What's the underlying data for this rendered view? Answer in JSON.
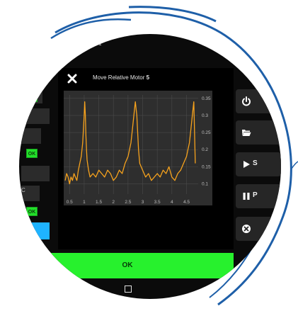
{
  "app": {
    "background_title": "on 1"
  },
  "left_panel": {
    "rows": [
      {
        "ok": "OK"
      },
      {
        "ok": ""
      },
      {
        "ok": ""
      },
      {
        "ok": "OK"
      },
      {
        "ok": ""
      },
      {
        "ok": "OK"
      }
    ],
    "row_label": "C"
  },
  "dialog": {
    "title_prefix": "Move Relative Motor",
    "motor_number": "5",
    "ok_label": "OK"
  },
  "side_buttons": [
    {
      "icon": "power-icon",
      "label": ""
    },
    {
      "icon": "folder-open-icon",
      "label": ""
    },
    {
      "icon": "play-icon",
      "label": "S"
    },
    {
      "icon": "pause-icon",
      "label": "P"
    },
    {
      "icon": "close-circle-icon",
      "label": ""
    }
  ],
  "colors": {
    "accent_green": "#27f12d",
    "trace_orange": "#f6a21d",
    "accent_blue": "#1fb3ff",
    "frame_blue": "#1e5fa8"
  },
  "chart_data": {
    "type": "line",
    "title": "",
    "xlabel": "",
    "ylabel": "",
    "x_ticks": [
      "0.5",
      "1",
      "1.5",
      "2",
      "2.5",
      "3",
      "3.5",
      "4",
      "4.5"
    ],
    "y_ticks": [
      "0.35",
      "0.3",
      "0.25",
      "0.2",
      "0.15",
      "0.1"
    ],
    "xlim": [
      0.3,
      4.9
    ],
    "ylim": [
      0.07,
      0.36
    ],
    "grid": true,
    "series": [
      {
        "x": [
          0.35,
          0.4,
          0.45,
          0.5,
          0.55,
          0.6,
          0.65,
          0.7,
          0.75,
          0.8,
          0.85,
          0.9,
          0.95,
          1.0,
          1.02,
          1.04,
          1.06,
          1.08,
          1.1,
          1.15,
          1.2,
          1.3,
          1.4,
          1.5,
          1.6,
          1.7,
          1.8,
          1.9,
          2.0,
          2.1,
          2.2,
          2.3,
          2.4,
          2.5,
          2.6,
          2.65,
          2.7,
          2.75,
          2.8,
          2.83,
          2.86,
          2.9,
          3.0,
          3.1,
          3.2,
          3.3,
          3.4,
          3.5,
          3.6,
          3.7,
          3.8,
          3.9,
          4.0,
          4.1,
          4.2,
          4.3,
          4.4,
          4.5,
          4.55,
          4.6,
          4.65,
          4.7,
          4.75,
          4.8
        ],
        "y": [
          0.11,
          0.13,
          0.12,
          0.1,
          0.12,
          0.11,
          0.13,
          0.12,
          0.11,
          0.14,
          0.16,
          0.18,
          0.22,
          0.3,
          0.34,
          0.3,
          0.24,
          0.2,
          0.17,
          0.14,
          0.12,
          0.13,
          0.12,
          0.14,
          0.13,
          0.12,
          0.14,
          0.13,
          0.11,
          0.12,
          0.14,
          0.13,
          0.16,
          0.18,
          0.22,
          0.26,
          0.3,
          0.34,
          0.3,
          0.25,
          0.2,
          0.16,
          0.14,
          0.12,
          0.13,
          0.11,
          0.12,
          0.13,
          0.12,
          0.14,
          0.13,
          0.15,
          0.12,
          0.11,
          0.13,
          0.14,
          0.16,
          0.18,
          0.2,
          0.22,
          0.26,
          0.3,
          0.34,
          0.16
        ]
      }
    ]
  }
}
